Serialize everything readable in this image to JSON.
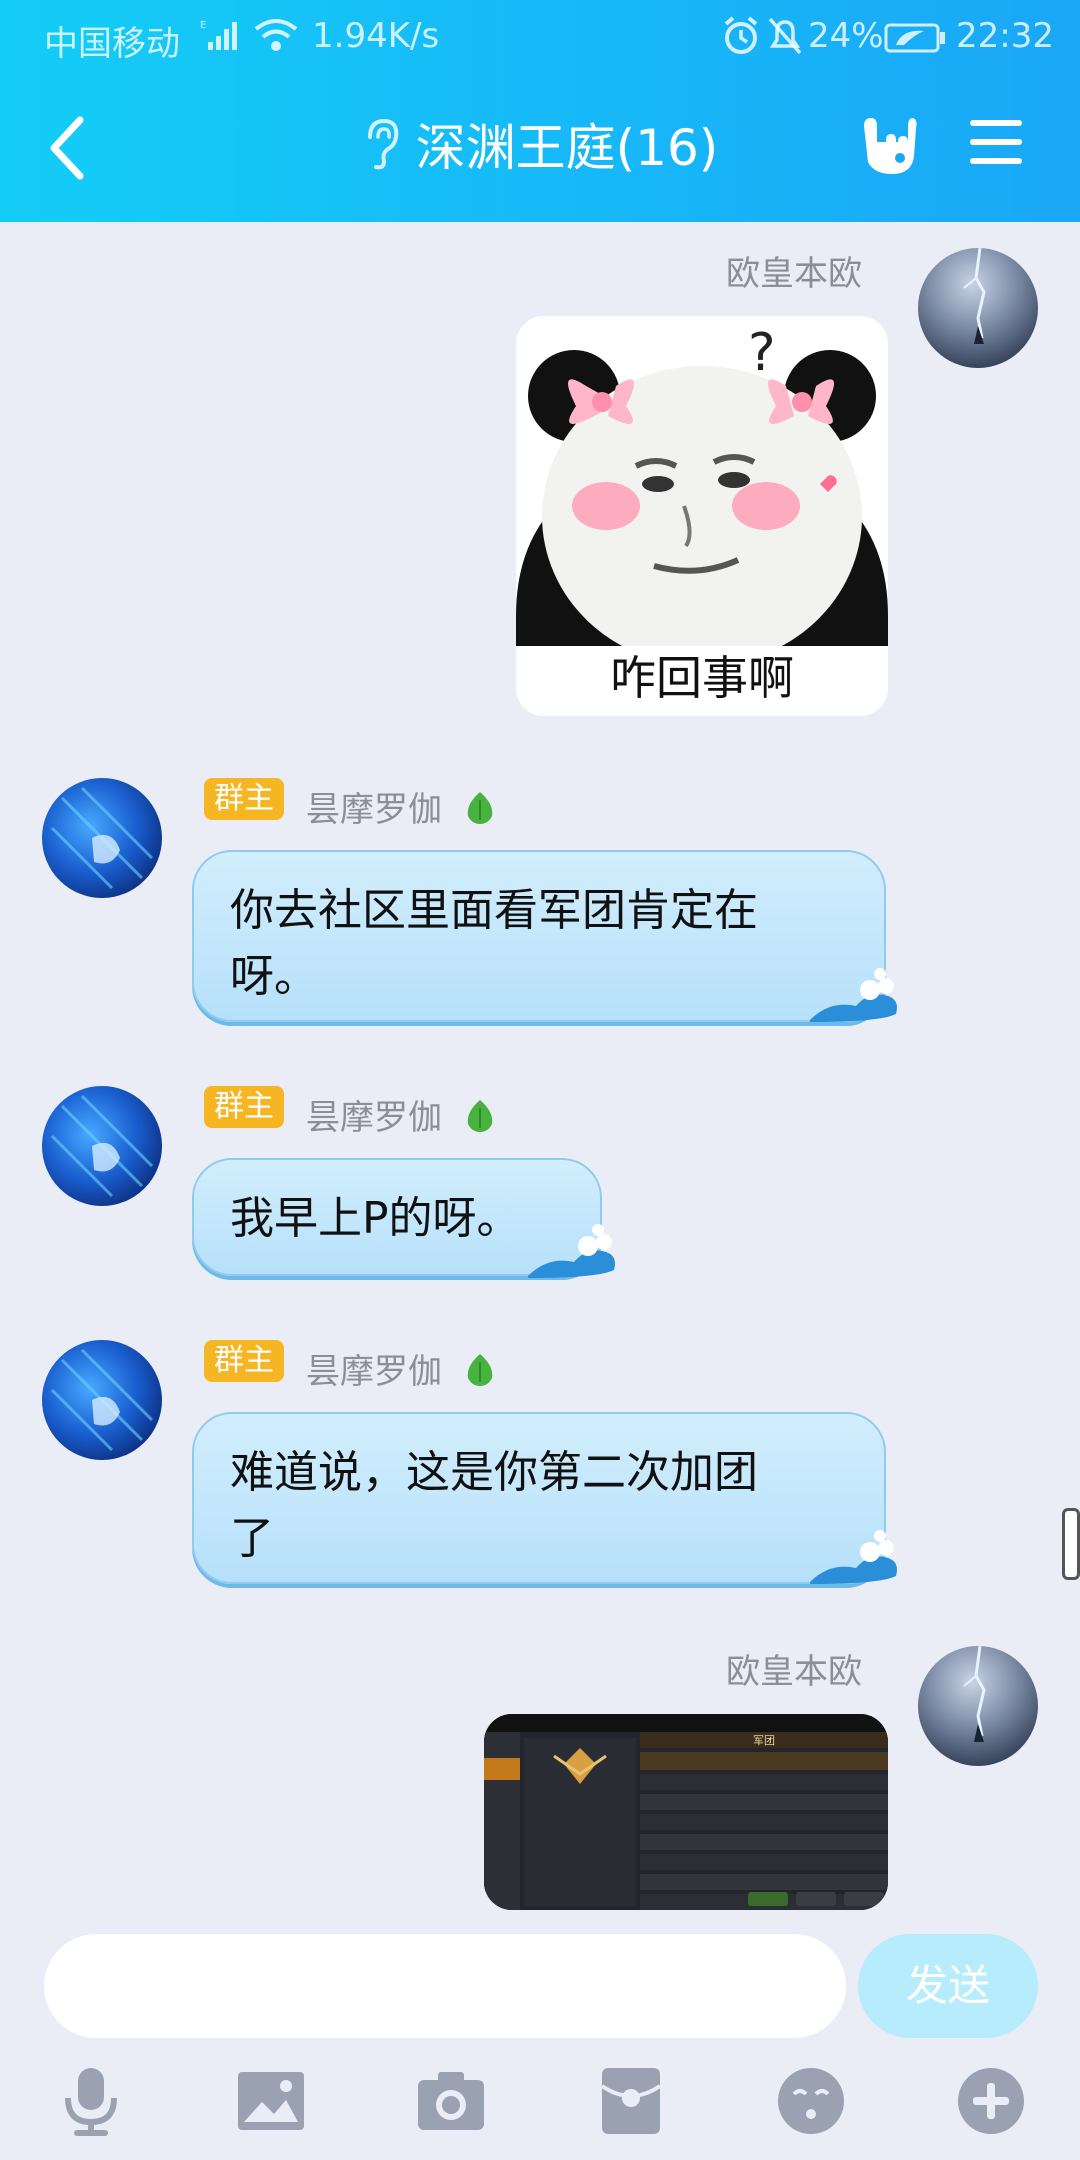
{
  "status_bar": {
    "carrier": "中国移动",
    "speed": "1.94K/s",
    "battery": "24%",
    "time": "22:32"
  },
  "header": {
    "title": "深渊王庭(16)"
  },
  "messages": [
    {
      "sender": "欧皇本欧",
      "kind": "sticker",
      "sticker_text": "咋回事啊"
    },
    {
      "badge": "群主",
      "sender": "昙摩罗伽",
      "lines": [
        "你去社区里面看军团肯定在",
        "呀。"
      ]
    },
    {
      "badge": "群主",
      "sender": "昙摩罗伽",
      "lines": [
        "我早上P的呀。"
      ]
    },
    {
      "badge": "群主",
      "sender": "昙摩罗伽",
      "lines": [
        "难道说，这是你第二次加团",
        "了"
      ]
    },
    {
      "sender": "欧皇本欧",
      "kind": "image",
      "image_caption": "军团"
    }
  ],
  "composer": {
    "send_label": "发送"
  },
  "toolbar": [
    "microphone-icon",
    "image-icon",
    "camera-icon",
    "red-packet-icon",
    "emoji-icon",
    "plus-icon"
  ]
}
